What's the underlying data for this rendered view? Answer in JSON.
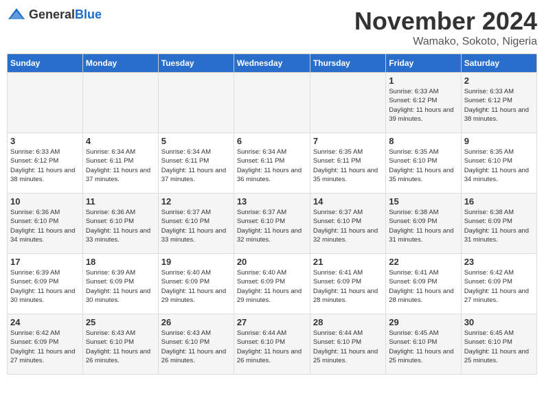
{
  "header": {
    "logo_general": "General",
    "logo_blue": "Blue",
    "month_title": "November 2024",
    "location": "Wamako, Sokoto, Nigeria"
  },
  "days_of_week": [
    "Sunday",
    "Monday",
    "Tuesday",
    "Wednesday",
    "Thursday",
    "Friday",
    "Saturday"
  ],
  "weeks": [
    [
      {
        "day": "",
        "info": ""
      },
      {
        "day": "",
        "info": ""
      },
      {
        "day": "",
        "info": ""
      },
      {
        "day": "",
        "info": ""
      },
      {
        "day": "",
        "info": ""
      },
      {
        "day": "1",
        "info": "Sunrise: 6:33 AM\nSunset: 6:12 PM\nDaylight: 11 hours and 39 minutes."
      },
      {
        "day": "2",
        "info": "Sunrise: 6:33 AM\nSunset: 6:12 PM\nDaylight: 11 hours and 38 minutes."
      }
    ],
    [
      {
        "day": "3",
        "info": "Sunrise: 6:33 AM\nSunset: 6:12 PM\nDaylight: 11 hours and 38 minutes."
      },
      {
        "day": "4",
        "info": "Sunrise: 6:34 AM\nSunset: 6:11 PM\nDaylight: 11 hours and 37 minutes."
      },
      {
        "day": "5",
        "info": "Sunrise: 6:34 AM\nSunset: 6:11 PM\nDaylight: 11 hours and 37 minutes."
      },
      {
        "day": "6",
        "info": "Sunrise: 6:34 AM\nSunset: 6:11 PM\nDaylight: 11 hours and 36 minutes."
      },
      {
        "day": "7",
        "info": "Sunrise: 6:35 AM\nSunset: 6:11 PM\nDaylight: 11 hours and 35 minutes."
      },
      {
        "day": "8",
        "info": "Sunrise: 6:35 AM\nSunset: 6:10 PM\nDaylight: 11 hours and 35 minutes."
      },
      {
        "day": "9",
        "info": "Sunrise: 6:35 AM\nSunset: 6:10 PM\nDaylight: 11 hours and 34 minutes."
      }
    ],
    [
      {
        "day": "10",
        "info": "Sunrise: 6:36 AM\nSunset: 6:10 PM\nDaylight: 11 hours and 34 minutes."
      },
      {
        "day": "11",
        "info": "Sunrise: 6:36 AM\nSunset: 6:10 PM\nDaylight: 11 hours and 33 minutes."
      },
      {
        "day": "12",
        "info": "Sunrise: 6:37 AM\nSunset: 6:10 PM\nDaylight: 11 hours and 33 minutes."
      },
      {
        "day": "13",
        "info": "Sunrise: 6:37 AM\nSunset: 6:10 PM\nDaylight: 11 hours and 32 minutes."
      },
      {
        "day": "14",
        "info": "Sunrise: 6:37 AM\nSunset: 6:10 PM\nDaylight: 11 hours and 32 minutes."
      },
      {
        "day": "15",
        "info": "Sunrise: 6:38 AM\nSunset: 6:09 PM\nDaylight: 11 hours and 31 minutes."
      },
      {
        "day": "16",
        "info": "Sunrise: 6:38 AM\nSunset: 6:09 PM\nDaylight: 11 hours and 31 minutes."
      }
    ],
    [
      {
        "day": "17",
        "info": "Sunrise: 6:39 AM\nSunset: 6:09 PM\nDaylight: 11 hours and 30 minutes."
      },
      {
        "day": "18",
        "info": "Sunrise: 6:39 AM\nSunset: 6:09 PM\nDaylight: 11 hours and 30 minutes."
      },
      {
        "day": "19",
        "info": "Sunrise: 6:40 AM\nSunset: 6:09 PM\nDaylight: 11 hours and 29 minutes."
      },
      {
        "day": "20",
        "info": "Sunrise: 6:40 AM\nSunset: 6:09 PM\nDaylight: 11 hours and 29 minutes."
      },
      {
        "day": "21",
        "info": "Sunrise: 6:41 AM\nSunset: 6:09 PM\nDaylight: 11 hours and 28 minutes."
      },
      {
        "day": "22",
        "info": "Sunrise: 6:41 AM\nSunset: 6:09 PM\nDaylight: 11 hours and 28 minutes."
      },
      {
        "day": "23",
        "info": "Sunrise: 6:42 AM\nSunset: 6:09 PM\nDaylight: 11 hours and 27 minutes."
      }
    ],
    [
      {
        "day": "24",
        "info": "Sunrise: 6:42 AM\nSunset: 6:09 PM\nDaylight: 11 hours and 27 minutes."
      },
      {
        "day": "25",
        "info": "Sunrise: 6:43 AM\nSunset: 6:10 PM\nDaylight: 11 hours and 26 minutes."
      },
      {
        "day": "26",
        "info": "Sunrise: 6:43 AM\nSunset: 6:10 PM\nDaylight: 11 hours and 26 minutes."
      },
      {
        "day": "27",
        "info": "Sunrise: 6:44 AM\nSunset: 6:10 PM\nDaylight: 11 hours and 26 minutes."
      },
      {
        "day": "28",
        "info": "Sunrise: 6:44 AM\nSunset: 6:10 PM\nDaylight: 11 hours and 25 minutes."
      },
      {
        "day": "29",
        "info": "Sunrise: 6:45 AM\nSunset: 6:10 PM\nDaylight: 11 hours and 25 minutes."
      },
      {
        "day": "30",
        "info": "Sunrise: 6:45 AM\nSunset: 6:10 PM\nDaylight: 11 hours and 25 minutes."
      }
    ]
  ]
}
